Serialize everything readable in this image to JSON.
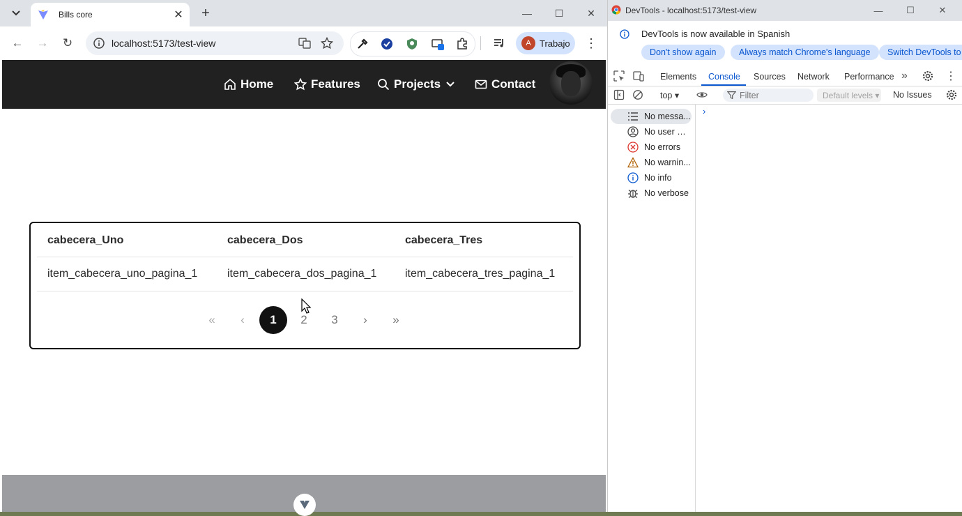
{
  "browser": {
    "tab_title": "Bills core",
    "url": "localhost:5173/test-view",
    "profile_name": "Trabajo",
    "profile_initial": "A",
    "accent": "#0b57d0"
  },
  "site": {
    "nav": {
      "home": "Home",
      "features": "Features",
      "projects": "Projects",
      "contact": "Contact"
    },
    "nav_bg": "#212121"
  },
  "table": {
    "headers": [
      "cabecera_Uno",
      "cabecera_Dos",
      "cabecera_Tres"
    ],
    "rows": [
      [
        "item_cabecera_uno_pagina_1",
        "item_cabecera_dos_pagina_1",
        "item_cabecera_tres_pagina_1"
      ]
    ]
  },
  "pagination": {
    "first": "«",
    "prev": "‹",
    "pages": [
      "1",
      "2",
      "3"
    ],
    "current_page": 1,
    "next": "›",
    "last": "»"
  },
  "devtools": {
    "window_title": "DevTools - localhost:5173/test-view",
    "info_message": "DevTools is now available in Spanish",
    "buttons": {
      "dont_show": "Don't show again",
      "match_language": "Always match Chrome's language",
      "switch": "Switch DevTools to"
    },
    "tabs": [
      "Elements",
      "Console",
      "Sources",
      "Network",
      "Performance"
    ],
    "active_tab": "Console",
    "context": "top ▾",
    "filter_placeholder": "Filter",
    "levels": "Default levels ▾",
    "issues": "No Issues",
    "sidebar": [
      {
        "label": "No messa...",
        "icon": "list-icon"
      },
      {
        "label": "No user m...",
        "icon": "user-icon"
      },
      {
        "label": "No errors",
        "icon": "error-icon"
      },
      {
        "label": "No warnin...",
        "icon": "warning-icon"
      },
      {
        "label": "No info",
        "icon": "info-icon"
      },
      {
        "label": "No verbose",
        "icon": "bug-icon"
      }
    ],
    "prompt": "›"
  }
}
